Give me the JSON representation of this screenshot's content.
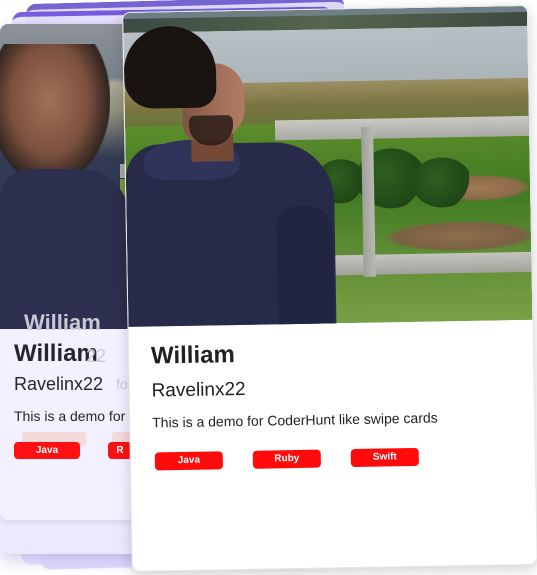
{
  "front_card": {
    "name": "William",
    "username": "Ravelinx22",
    "description": "This is a demo for CoderHunt like swipe cards",
    "tags": [
      "Java",
      "Ruby",
      "Swift"
    ]
  },
  "back_card": {
    "ghost_name": "William",
    "ghost_username": "22",
    "ghost_for": "for",
    "name": "William",
    "username": "Ravelinx22",
    "description": "This is a demo for",
    "tags": [
      "Java",
      "R"
    ]
  },
  "colors": {
    "tag_background": "#ff0b0b",
    "tag_text": "#ffffff",
    "stack_accent": "#4a2fc4"
  }
}
